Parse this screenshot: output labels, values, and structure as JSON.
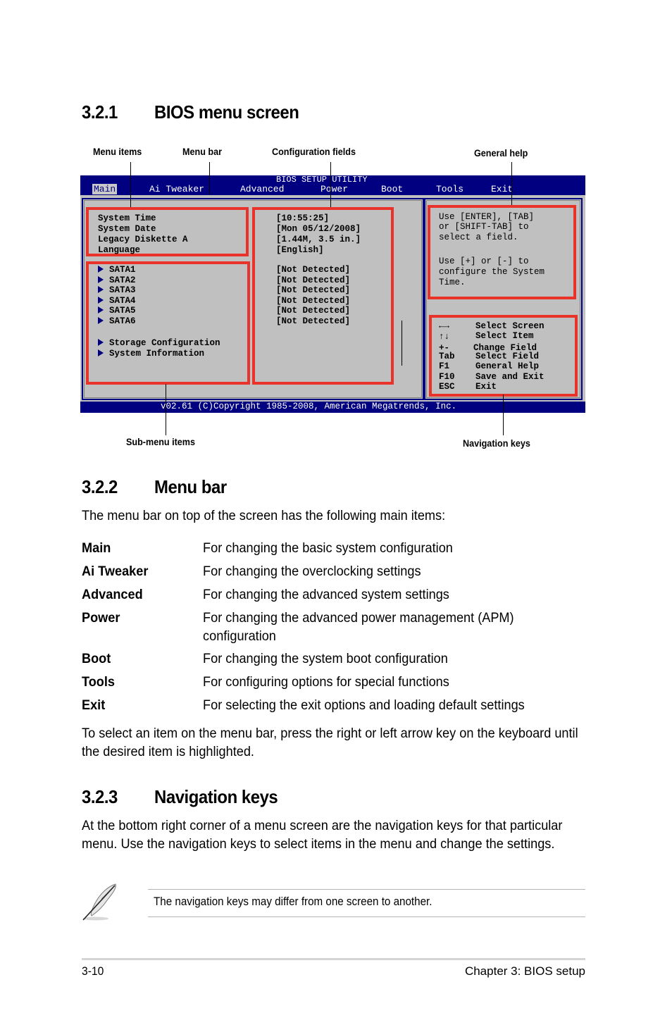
{
  "section_1": {
    "number": "3.2.1",
    "title": "BIOS menu screen",
    "callouts": {
      "menu_items": "Menu items",
      "menu_bar": "Menu bar",
      "configuration_fields": "Configuration fields",
      "general_help": "General help",
      "sub_menu_items": "Sub-menu items",
      "navigation_keys": "Navigation keys"
    },
    "bios": {
      "title": "BIOS SETUP UTILITY",
      "menu": [
        "Main",
        "Ai Tweaker",
        "Advanced",
        "Power",
        "Boot",
        "Tools",
        "Exit"
      ],
      "active_menu": "Main",
      "items": [
        "System Time",
        "System Date",
        "Legacy Diskette A",
        "Language"
      ],
      "values": [
        "[10:55:25]",
        "[Mon 05/12/2008]",
        "[1.44M, 3.5 in.]",
        "[English]"
      ],
      "submenus": [
        "SATA1",
        "SATA2",
        "SATA3",
        "SATA4",
        "SATA5",
        "SATA6"
      ],
      "submenu_values": [
        "[Not Detected]",
        "[Not Detected]",
        "[Not Detected]",
        "[Not Detected]",
        "[Not Detected]",
        "[Not Detected]"
      ],
      "extra_submenus": [
        "Storage Configuration",
        "System Information"
      ],
      "help_lines": [
        "Use [ENTER], [TAB]",
        "or [SHIFT-TAB] to",
        "select a field.",
        "",
        "Use [+] or [-] to",
        "configure the System",
        "Time."
      ],
      "nav_keys": [
        {
          "key": "←→",
          "action": "Select Screen"
        },
        {
          "key": "↑↓",
          "action": "Select Item"
        },
        {
          "key": "+-",
          "action": "Change Field"
        },
        {
          "key": "Tab",
          "action": "Select Field"
        },
        {
          "key": "F1",
          "action": "General Help"
        },
        {
          "key": "F10",
          "action": "Save and Exit"
        },
        {
          "key": "ESC",
          "action": "Exit"
        }
      ],
      "footer": "v02.61 (C)Copyright 1985-2008, American Megatrends, Inc.",
      "colors": {
        "bar": "#000080",
        "panel": "#c0c0c0",
        "highlight_box": "#e8322a"
      }
    }
  },
  "section_2": {
    "number": "3.2.2",
    "title": "Menu bar",
    "intro": "The menu bar on top of the screen has the following main items:",
    "items": [
      {
        "term": "Main",
        "def": "For changing the basic system configuration"
      },
      {
        "term": "Ai Tweaker",
        "def": "For changing the overclocking settings"
      },
      {
        "term": "Advanced",
        "def": "For changing the advanced system settings"
      },
      {
        "term": "Power",
        "def": "For changing the advanced power management (APM) configuration"
      },
      {
        "term": "Boot",
        "def": "For changing the system boot configuration"
      },
      {
        "term": "Tools",
        "def": "For configuring options for special functions"
      },
      {
        "term": "Exit",
        "def": "For selecting the exit options and loading default settings"
      }
    ],
    "outro": "To select an item on the menu bar, press the right or left arrow key on the keyboard until the desired item is highlighted."
  },
  "section_3": {
    "number": "3.2.3",
    "title": "Navigation keys",
    "body": "At the bottom right corner of a menu screen are the navigation keys for that particular menu. Use the navigation keys to select items in the menu and change the settings.",
    "note": "The navigation keys may differ from one screen to another."
  },
  "footer": {
    "page": "3-10",
    "chapter": "Chapter 3: BIOS setup"
  }
}
